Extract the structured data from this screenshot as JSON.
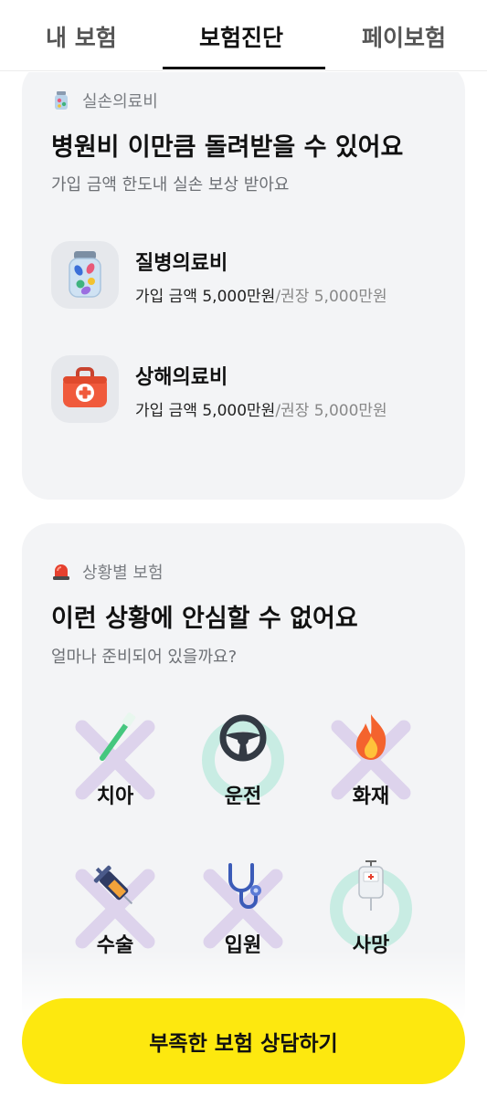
{
  "tabs": [
    {
      "label": "내 보험"
    },
    {
      "label": "보험진단"
    },
    {
      "label": "페이보험"
    }
  ],
  "active_tab": "보험진단",
  "medical_card": {
    "eyebrow": "실손의료비",
    "eyebrow_icon": "medicine-bottle-icon",
    "title": "병원비 이만큼 돌려받을 수 있어요",
    "subtitle": "가입 금액 한도내 실손 보상 받아요",
    "items": [
      {
        "name": "질병의료비",
        "icon": "pill-bottle-icon",
        "amount": "가입 금액 5,000만원",
        "recommended": "/권장 5,000만원"
      },
      {
        "name": "상해의료비",
        "icon": "first-aid-kit-icon",
        "amount": "가입 금액 5,000만원",
        "recommended": "/권장 5,000만원"
      }
    ]
  },
  "situation_card": {
    "eyebrow": "상황별 보험",
    "eyebrow_icon": "siren-icon",
    "title": "이런 상황에 안심할 수 없어요",
    "subtitle": "얼마나 준비되어 있을까요?",
    "items": [
      {
        "label": "치아",
        "icon": "toothbrush-icon",
        "covered": false
      },
      {
        "label": "운전",
        "icon": "steering-wheel-icon",
        "covered": true
      },
      {
        "label": "화재",
        "icon": "fire-icon",
        "covered": false
      },
      {
        "label": "수술",
        "icon": "syringe-icon",
        "covered": false
      },
      {
        "label": "입원",
        "icon": "stethoscope-icon",
        "covered": false
      },
      {
        "label": "사망",
        "icon": "iv-bag-icon",
        "covered": true
      }
    ]
  },
  "cta": {
    "label": "부족한 보험 상담하기"
  },
  "colors": {
    "accent_yellow": "#fde80f",
    "covered_ring": "#c8ece3",
    "uncovered_x": "#ddd3ec",
    "card_bg": "#f3f4f6"
  }
}
